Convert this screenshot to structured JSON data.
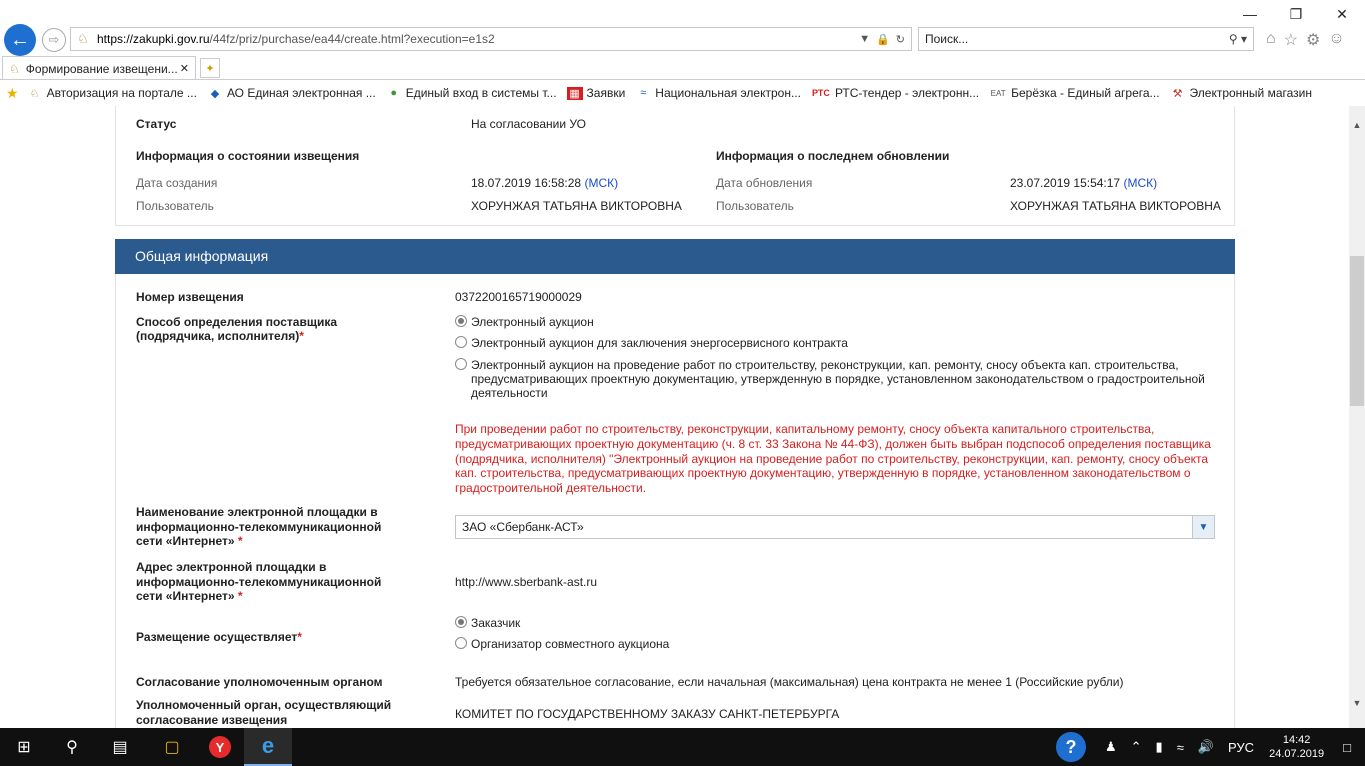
{
  "browser": {
    "url_host": "https://zakupki.gov.ru",
    "url_rest": "/44fz/priz/purchase/ea44/create.html?execution=e1s2",
    "search_placeholder": "Поиск...",
    "tab_title": "Формирование извещени...",
    "favorites": [
      {
        "icon": "gov-emblem-icon",
        "label": "Авторизация на портале ..."
      },
      {
        "icon": "diamond-logo-icon",
        "label": "АО Единая электронная ..."
      },
      {
        "icon": "green-globe-icon",
        "label": "Единый вход в системы т..."
      },
      {
        "icon": "red-logo-icon",
        "label": "Заявки"
      },
      {
        "icon": "wave-logo-icon",
        "label": "Национальная электрон..."
      },
      {
        "icon": "rts-logo-icon",
        "icon_text": "РТС",
        "label": "РТС-тендер - электронн..."
      },
      {
        "icon": "eat-logo-icon",
        "icon_text": "EAT",
        "label": "Берёзка - Единый агрега..."
      },
      {
        "icon": "tools-icon",
        "label": "Электронный магазин"
      }
    ]
  },
  "status_panel": {
    "status_label": "Статус",
    "status_value": "На согласовании УО",
    "state_heading": "Информация о состоянии извещения",
    "update_heading": "Информация о последнем обновлении",
    "created_label": "Дата создания",
    "created_value": "18.07.2019 16:58:28",
    "tz": "(МСК)",
    "user_label": "Пользователь",
    "user_value": "ХОРУНЖАЯ ТАТЬЯНА ВИКТОРОВНА",
    "updated_label": "Дата обновления",
    "updated_value": "23.07.2019 15:54:17",
    "update_user_label": "Пользователь",
    "update_user_value": "ХОРУНЖАЯ ТАТЬЯНА ВИКТОРОВНА"
  },
  "general": {
    "header": "Общая информация",
    "notice_number_label": "Номер извещения",
    "notice_number_value": "0372200165719000029",
    "method_label_1": "Способ определения поставщика",
    "method_label_2": "(подрядчика, исполнителя)",
    "required_mark": "*",
    "method_options": [
      {
        "label": "Электронный аукцион",
        "selected": true
      },
      {
        "label": "Электронный аукцион для заключения энергосервисного контракта",
        "selected": false
      },
      {
        "label": "Электронный аукцион на проведение работ по строительству, реконструкции, кап. ремонту, сносу объекта кап. строительства, предусматривающих проектную документацию, утвержденную в порядке, установленном законодательством о градостроительной деятельности",
        "selected": false
      }
    ],
    "warning": "При проведении работ по строительству, реконструкции, капитальному ремонту, сносу объекта капитального строительства, предусматривающих проектную документацию (ч. 8 ст. 33 Закона № 44-ФЗ), должен быть выбран подспособ определения поставщика (подрядчика, исполнителя) \"Электронный аукцион на проведение работ по строительству, реконструкции, кап. ремонту, сносу объекта кап. строительства, предусматривающих проектную документацию, утвержденную в порядке, установленном законодательством о градостроительной деятельности.",
    "platform_name_label_1": "Наименование электронной площадки в",
    "platform_name_label_2": "информационно-телекоммуникационной",
    "platform_name_label_3": "сети «Интернет»",
    "platform_name_value": "ЗАО «Сбербанк-АСТ»",
    "platform_addr_label_1": "Адрес электронной площадки в",
    "platform_addr_label_2": "информационно-телекоммуникационной",
    "platform_addr_label_3": "сети «Интернет»",
    "platform_addr_value": "http://www.sberbank-ast.ru",
    "placement_label": "Размещение осуществляет",
    "placement_options": [
      {
        "label": "Заказчик",
        "selected": true
      },
      {
        "label": "Организатор совместного аукциона",
        "selected": false
      }
    ],
    "approval_label": "Согласование уполномоченным органом",
    "approval_value": "Требуется обязательное согласование, если начальная (максимальная) цена контракта не менее 1 (Российские рубли)",
    "authority_label_1": "Уполномоченный орган, осуществляющий",
    "authority_label_2": "согласование извещения",
    "authority_value": "КОМИТЕТ ПО ГОСУДАРСТВЕННОМУ ЗАКАЗУ САНКТ-ПЕТЕРБУРГА"
  },
  "taskbar": {
    "language": "РУС",
    "time": "14:42",
    "date": "24.07.2019"
  }
}
